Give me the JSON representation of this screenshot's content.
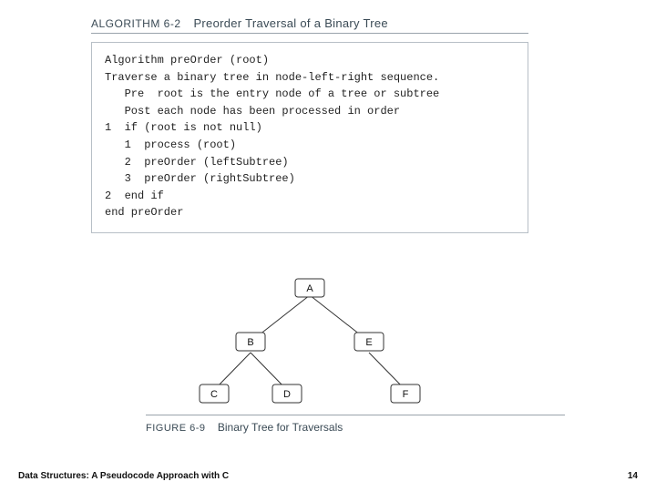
{
  "algorithm": {
    "label": "ALGORITHM 6-2",
    "title": "Preorder Traversal of a Binary Tree",
    "code": "Algorithm preOrder (root)\nTraverse a binary tree in node-left-right sequence.\n   Pre  root is the entry node of a tree or subtree\n   Post each node has been processed in order\n1  if (root is not null)\n   1  process (root)\n   2  preOrder (leftSubtree)\n   3  preOrder (rightSubtree)\n2  end if\nend preOrder"
  },
  "tree": {
    "nodes": {
      "A": "A",
      "B": "B",
      "E": "E",
      "C": "C",
      "D": "D",
      "F": "F"
    }
  },
  "figure": {
    "label": "FIGURE 6-9",
    "title": "Binary Tree for Traversals"
  },
  "footer": {
    "left": "Data Structures: A Pseudocode Approach with C",
    "right": "14"
  }
}
